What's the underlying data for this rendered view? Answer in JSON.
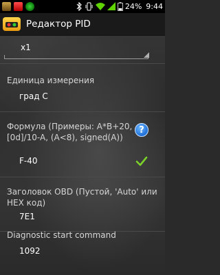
{
  "status_bar": {
    "battery_percent": "24%",
    "time": "9:44",
    "icons": [
      "app-notification-icon",
      "shield-icon",
      "ladybug-icon",
      "bluetooth-icon",
      "vibrate-icon",
      "wifi-icon",
      "signal-icon",
      "battery-icon"
    ]
  },
  "app_bar": {
    "title": "Редактор PID",
    "icon": "car-dashboard-icon"
  },
  "form": {
    "multiplier_value": "x1",
    "unit": {
      "label": "Единица измерения",
      "value": "град С"
    },
    "formula": {
      "label": "Формула (Примеры: A*B+20, [0d]/10-A, (A<8), signed(A))",
      "value": "F-40"
    },
    "obd_header": {
      "label": "Заголовок OBD (Пустой, 'Auto' или HEX код)",
      "value": "7E1"
    },
    "diagnostic": {
      "label": "Diagnostic start command",
      "value": "1092"
    }
  },
  "colors": {
    "accent_green": "#7bd12a",
    "help_blue": "#2a7fe0"
  }
}
